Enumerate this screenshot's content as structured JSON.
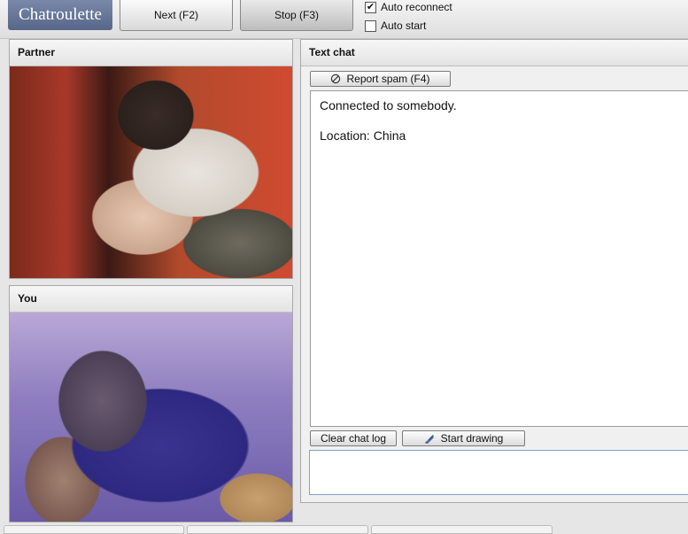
{
  "header": {
    "logo": "Chatroulette",
    "next_label": "Next (F2)",
    "stop_label": "Stop (F3)",
    "auto_reconnect": {
      "label": "Auto reconnect",
      "checked": true,
      "mark": "✔"
    },
    "auto_start": {
      "label": "Auto start",
      "checked": false,
      "mark": ""
    }
  },
  "partner_panel": {
    "title": "Partner"
  },
  "you_panel": {
    "title": "You"
  },
  "chat": {
    "title": "Text chat",
    "report_label": "Report spam (F4)",
    "report_icon": "prohibited-icon",
    "messages": [
      "Connected to somebody.",
      "Location: China"
    ],
    "clear_label": "Clear chat log",
    "draw_label": "Start drawing",
    "draw_icon": "pencil-icon",
    "input_value": ""
  },
  "colors": {
    "logo_bg": "#5f6f92",
    "input_border": "#7fa3c8"
  }
}
